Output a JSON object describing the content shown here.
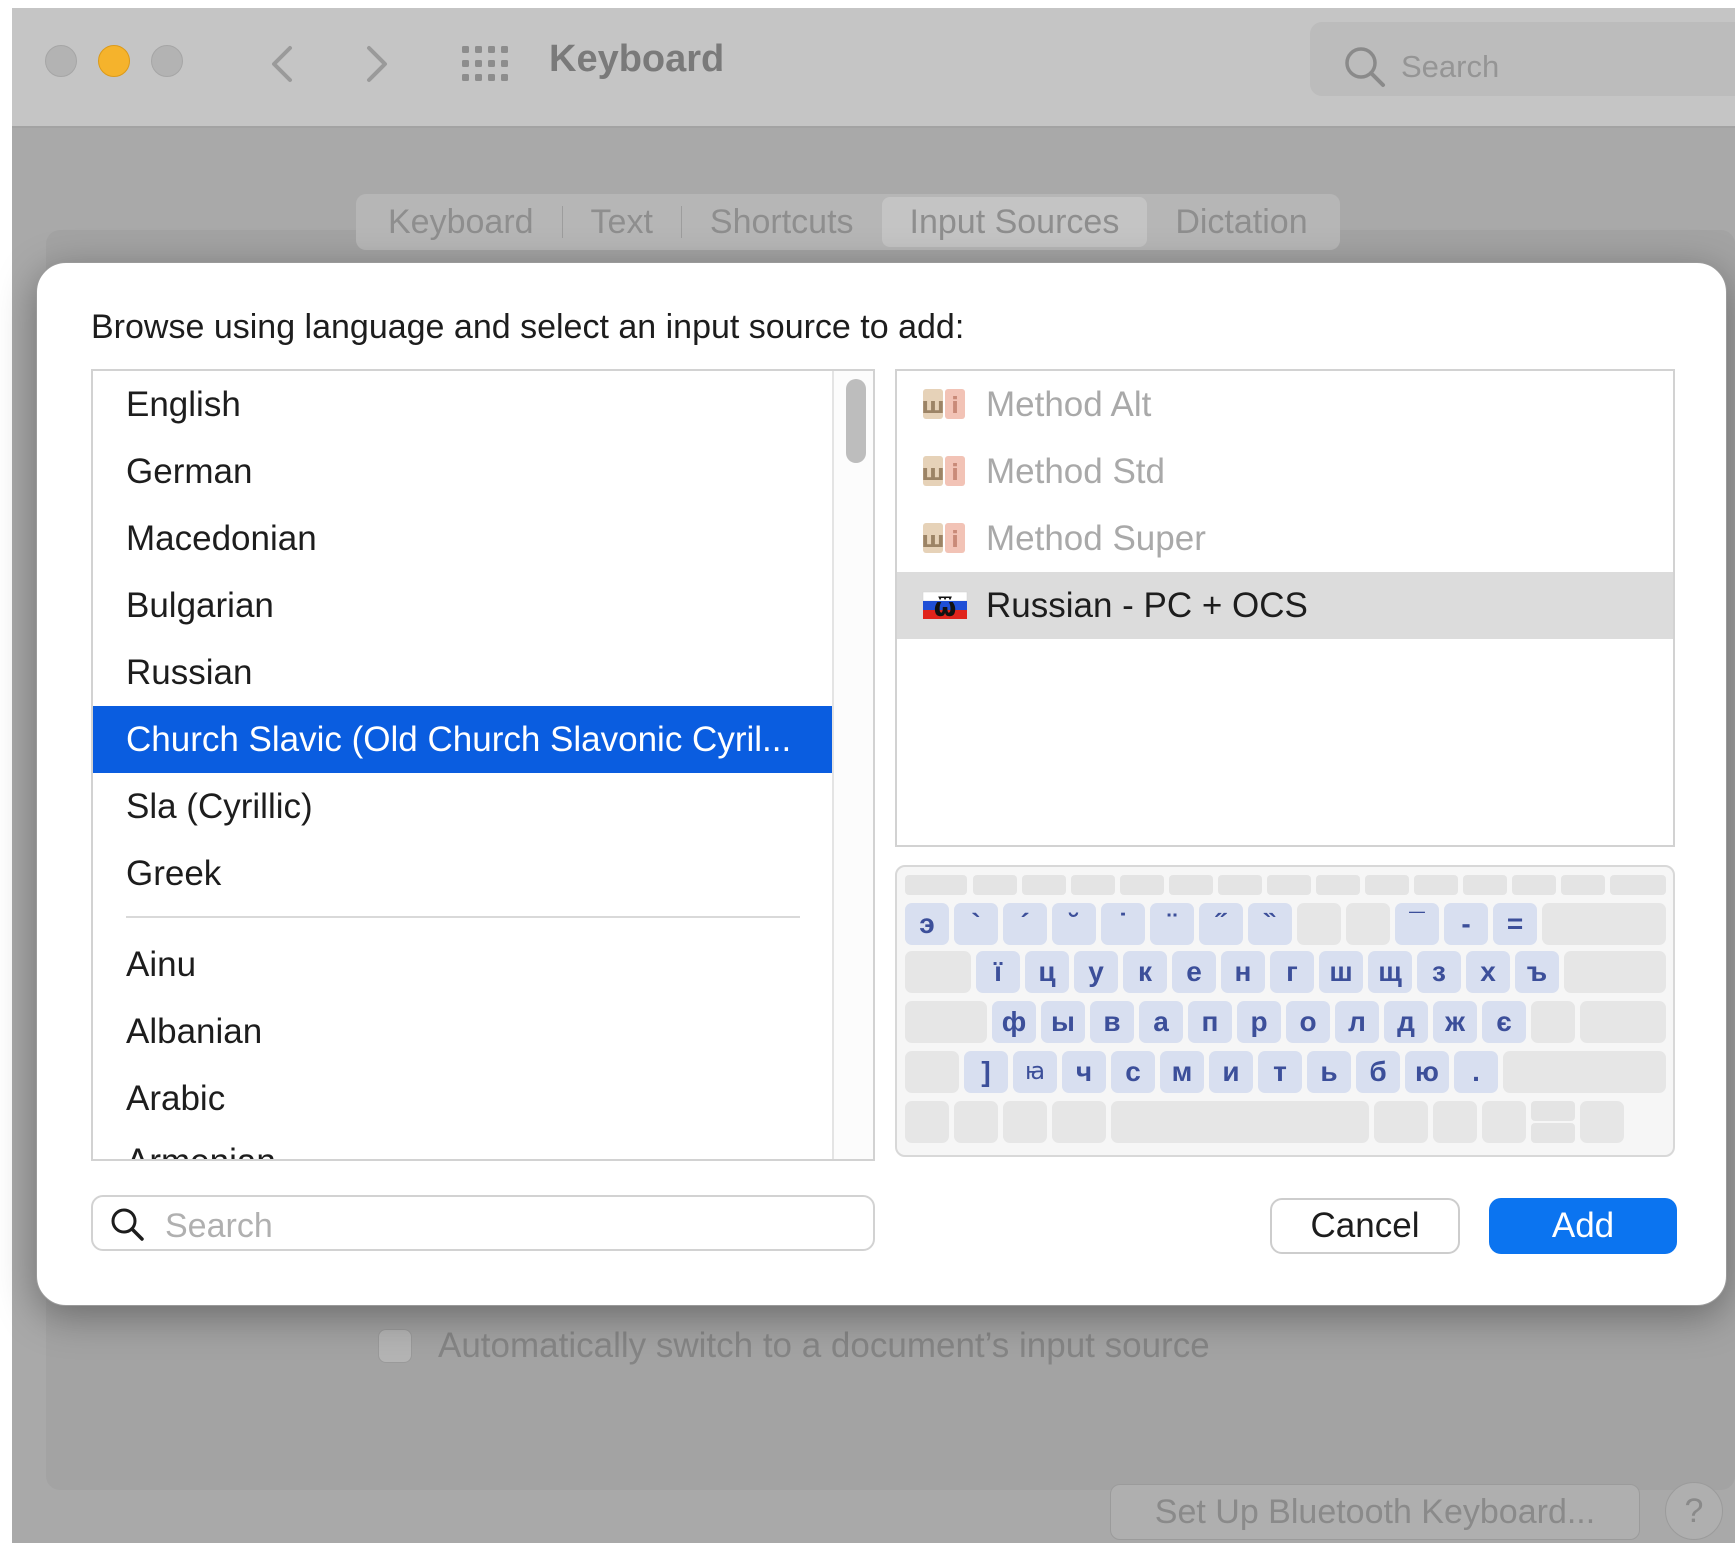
{
  "window": {
    "title": "Keyboard",
    "search_placeholder": "Search",
    "tabs": [
      {
        "label": "Keyboard",
        "active": false
      },
      {
        "label": "Text",
        "active": false
      },
      {
        "label": "Shortcuts",
        "active": false
      },
      {
        "label": "Input Sources",
        "active": true
      },
      {
        "label": "Dictation",
        "active": false
      }
    ],
    "auto_switch_label": "Automatically switch to a document’s input source",
    "bluetooth_button": "Set Up Bluetooth Keyboard...",
    "help_button": "?"
  },
  "dialog": {
    "prompt": "Browse using language and select an input source to add:",
    "languages_top": [
      "English",
      "German",
      "Macedonian",
      "Bulgarian",
      "Russian",
      "Church Slavic (Old Church Slavonic Cyril...",
      "Sla (Cyrillic)",
      "Greek"
    ],
    "languages_all": [
      "Ainu",
      "Albanian",
      "Arabic",
      "Armenian"
    ],
    "selected_language": "Church Slavic (Old Church Slavonic Cyril...",
    "input_sources": [
      {
        "label": "Method Alt",
        "enabled": false,
        "icon": "method-icon"
      },
      {
        "label": "Method Std",
        "enabled": false,
        "icon": "method-icon"
      },
      {
        "label": "Method Super",
        "enabled": false,
        "icon": "method-icon"
      },
      {
        "label": "Russian - PC + OCS",
        "enabled": true,
        "selected": true,
        "icon": "russian-flag-icon"
      }
    ],
    "keyboard_rows": {
      "row1": [
        "э",
        "`",
        "´",
        "˘",
        "˙",
        "¨",
        "˝",
        "̏",
        "",
        "",
        "¯",
        "-",
        "="
      ],
      "row2": [
        "ї",
        "ц",
        "у",
        "к",
        "е",
        "н",
        "г",
        "ш",
        "щ",
        "з",
        "х",
        "ъ"
      ],
      "row3": [
        "ф",
        "ы",
        "в",
        "а",
        "п",
        "р",
        "о",
        "л",
        "д",
        "ж",
        "є"
      ],
      "row4": [
        "]",
        "ꙗ",
        "ч",
        "с",
        "м",
        "и",
        "т",
        "ь",
        "б",
        "ю",
        "."
      ]
    },
    "search_placeholder": "Search",
    "cancel_label": "Cancel",
    "add_label": "Add"
  },
  "colors": {
    "selection_blue": "#0a5de0",
    "add_button_blue": "#0b74f0",
    "minimize_yellow": "#f5b32c",
    "key_text": "#3c4f9a"
  }
}
